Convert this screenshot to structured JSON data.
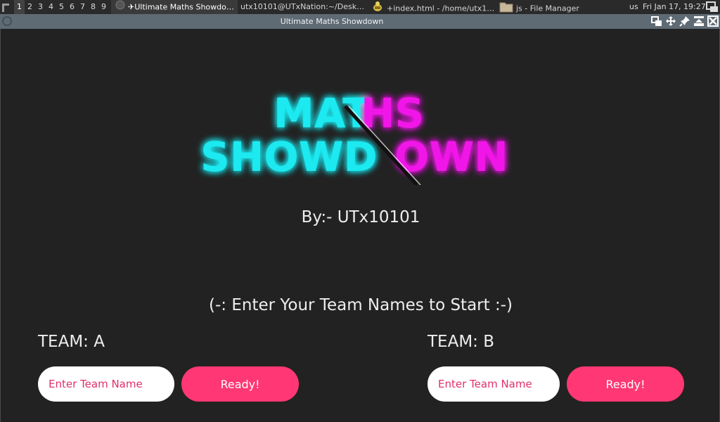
{
  "panel": {
    "workspaces": [
      "1",
      "2",
      "3",
      "4",
      "5",
      "6",
      "7",
      "8",
      "9"
    ],
    "active_workspace": "1",
    "tasks": [
      {
        "label": "✈Ultimate Maths Showdo…",
        "icon": "browser-icon"
      },
      {
        "label": "utx10101@UTxNation:~/Desk…",
        "icon": ""
      },
      {
        "label": "+index.html - /home/utx1…",
        "icon": "text-editor-icon"
      },
      {
        "label": "js - File Manager",
        "icon": "folder-icon"
      }
    ],
    "keyboard_layout": "us",
    "clock": "Fri Jan 17, 19:27"
  },
  "window": {
    "title": "Ultimate Maths Showdown",
    "buttons": [
      "restore-icon",
      "move-icon",
      "pin-icon",
      "maximize-icon",
      "close-icon"
    ]
  },
  "app": {
    "logo": {
      "line1_left": "MAT",
      "line1_right": "HS",
      "line2_left": "SHOWD",
      "line2_right": "OWN",
      "colors": {
        "cyan": "#1de9f0",
        "magenta": "#f018e8",
        "white": "#ffffff",
        "glow": "#3a4dff"
      }
    },
    "byline": "By:- UTx10101",
    "prompt": "(-: Enter Your Team Names to Start :-)",
    "team_a": {
      "label": "TEAM: A",
      "placeholder": "Enter Team Name",
      "button": "Ready!"
    },
    "team_b": {
      "label": "TEAM: B",
      "placeholder": "Enter Team Name",
      "button": "Ready!"
    },
    "colors": {
      "accent": "#ff3774",
      "background": "#222222",
      "text": "#eeeeee"
    }
  }
}
